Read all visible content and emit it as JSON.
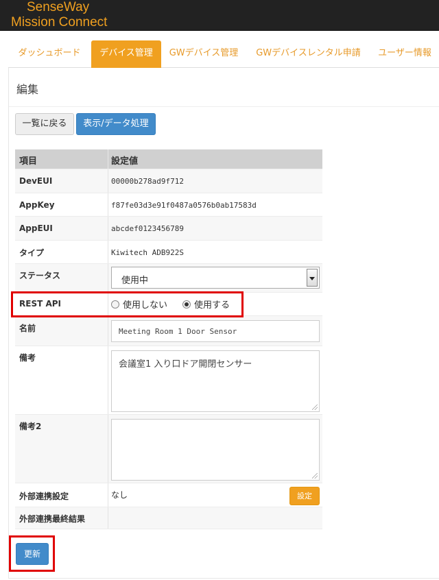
{
  "brand": {
    "line1": "SenseWay",
    "line2": "Mission Connect"
  },
  "nav": {
    "tabs": [
      {
        "label": "ダッシュボード",
        "active": false
      },
      {
        "label": "デバイス管理",
        "active": true
      },
      {
        "label": "GWデバイス管理",
        "active": false
      },
      {
        "label": "GWデバイスレンタル申請",
        "active": false
      },
      {
        "label": "ユーザー情報",
        "active": false
      }
    ]
  },
  "page": {
    "title": "編集"
  },
  "actions": {
    "back_label": "一覧に戻る",
    "display_label": "表示/データ処理"
  },
  "table": {
    "headers": {
      "item": "項目",
      "value": "設定値"
    },
    "dev_eui": {
      "label": "DevEUI",
      "value": "00000b278ad9f712"
    },
    "app_key": {
      "label": "AppKey",
      "value": "f87fe03d3e91f0487a0576b0ab17583d"
    },
    "app_eui": {
      "label": "AppEUI",
      "value": "abcdef0123456789"
    },
    "type": {
      "label": "タイプ",
      "value": "Kiwitech ADB922S"
    },
    "status": {
      "label": "ステータス",
      "selected": "使用中"
    },
    "rest_api": {
      "label": "REST API",
      "options": [
        "使用しない",
        "使用する"
      ],
      "selected": "使用する"
    },
    "name": {
      "label": "名前",
      "value": "Meeting Room 1 Door Sensor"
    },
    "note": {
      "label": "備考",
      "value": "会議室1 入り口ドア開閉センサー"
    },
    "note2": {
      "label": "備考2",
      "value": ""
    },
    "external": {
      "label": "外部連携設定",
      "value": "なし",
      "button_label": "設定"
    },
    "external_result": {
      "label": "外部連携最終結果",
      "value": ""
    }
  },
  "submit": {
    "label": "更新"
  },
  "colors": {
    "accent": "#f0a020",
    "primary": "#428bca",
    "highlight": "#e00000",
    "topbar": "#222222"
  }
}
